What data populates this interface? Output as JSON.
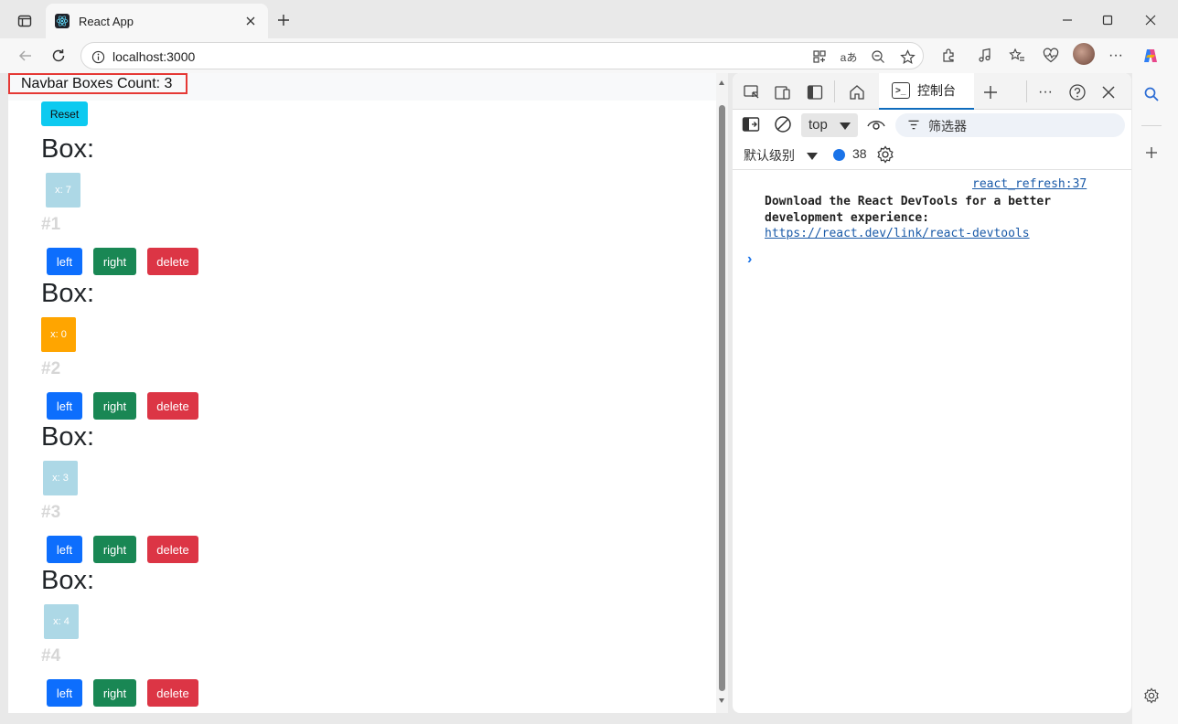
{
  "browser": {
    "tab_title": "React App",
    "url": "localhost:3000"
  },
  "page": {
    "navbar_count_label": "Navbar Boxes Count: 3",
    "reset_label": "Reset",
    "boxes": [
      {
        "title": "Box:",
        "x_label": "x: 7",
        "number": "#1",
        "color": "#add8e6",
        "left_label": "left",
        "right_label": "right",
        "delete_label": "delete"
      },
      {
        "title": "Box:",
        "x_label": "x: 0",
        "number": "#2",
        "color": "#ffa500",
        "left_label": "left",
        "right_label": "right",
        "delete_label": "delete"
      },
      {
        "title": "Box:",
        "x_label": "x: 3",
        "number": "#3",
        "color": "#add8e6",
        "left_label": "left",
        "right_label": "right",
        "delete_label": "delete"
      },
      {
        "title": "Box:",
        "x_label": "x: 4",
        "number": "#4",
        "color": "#add8e6",
        "left_label": "left",
        "right_label": "right",
        "delete_label": "delete"
      }
    ]
  },
  "devtools": {
    "console_tab_label": "控制台",
    "context_select": "top",
    "filter_placeholder": "筛选器",
    "level_label": "默认级别",
    "message_count": "38",
    "message": {
      "source": "react_refresh:37",
      "text": "Download the React DevTools for a better development experience:",
      "link": "https://react.dev/link/react-devtools"
    },
    "prompt_symbol": "›"
  },
  "colors": {
    "reset_button": "#0dcaf0",
    "left_button": "#0d6efd",
    "right_button": "#198754",
    "delete_button": "#dc3545",
    "highlight_outline": "#e53935"
  }
}
